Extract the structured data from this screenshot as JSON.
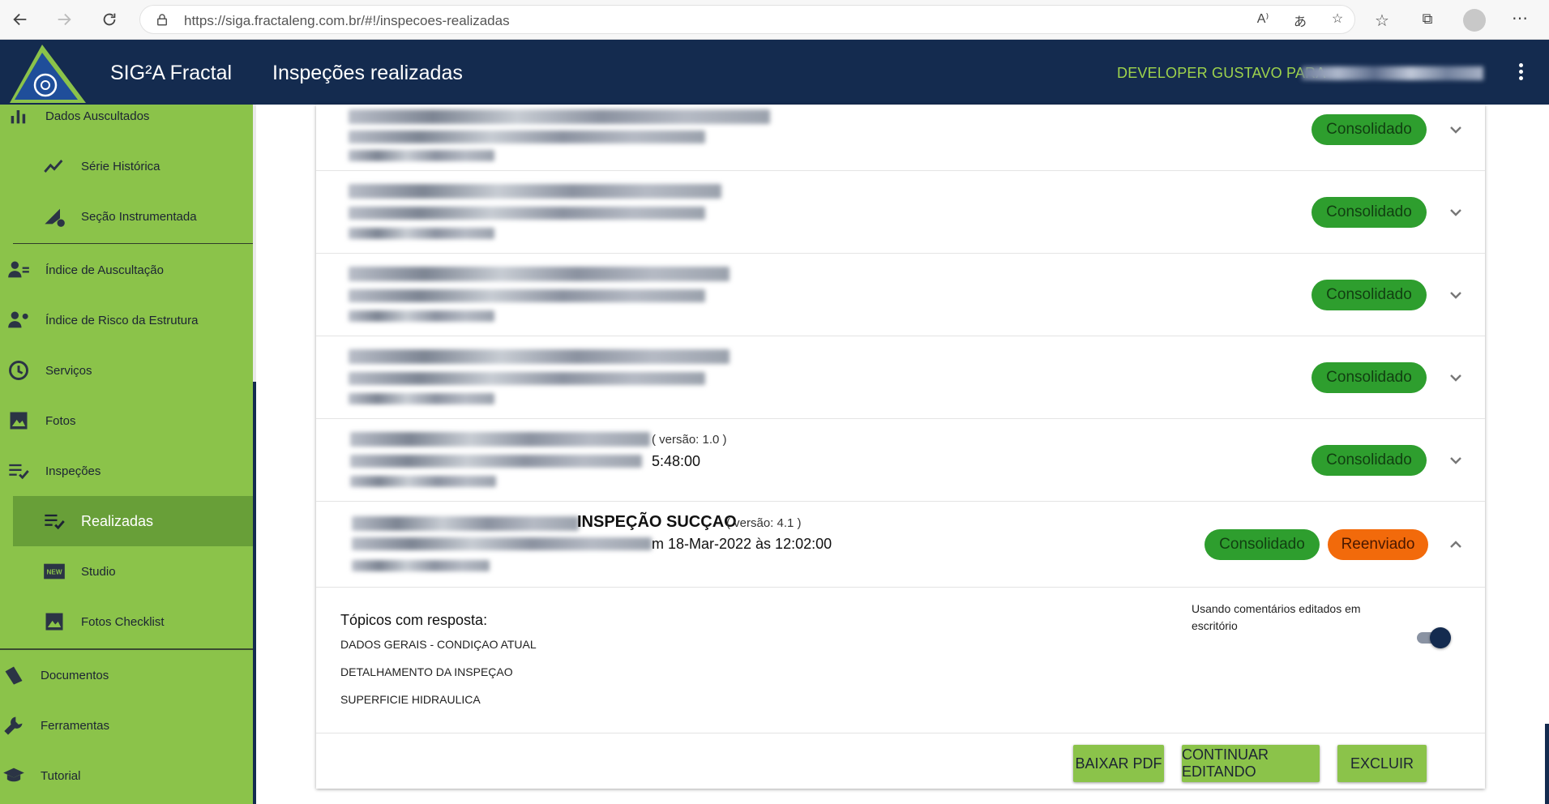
{
  "browser": {
    "url": "https://siga.fractaleng.com.br/#!/inspecoes-realizadas"
  },
  "header": {
    "app_name": "SIG²A Fractal",
    "page_title": "Inspeções realizadas",
    "user_name": "DEVELOPER GUSTAVO PARA"
  },
  "sidebar": {
    "items": [
      {
        "label": "Dados Auscultados",
        "icon": "bar-chart-icon"
      },
      {
        "label": "Série Histórica",
        "icon": "trend-line-icon"
      },
      {
        "label": "Seção Instrumentada",
        "icon": "ruler-gear-icon"
      },
      {
        "label": "Índice de Auscultação",
        "icon": "person-list-icon"
      },
      {
        "label": "Índice de Risco da Estrutura",
        "icon": "person-gear-icon"
      },
      {
        "label": "Serviços",
        "icon": "clock-icon"
      },
      {
        "label": "Fotos",
        "icon": "image-icon"
      },
      {
        "label": "Inspeções",
        "icon": "checklist-icon"
      },
      {
        "label": "Realizadas",
        "icon": "checklist-icon"
      },
      {
        "label": "Studio",
        "icon": "new-badge-icon"
      },
      {
        "label": "Fotos Checklist",
        "icon": "image-icon"
      },
      {
        "label": "Documentos",
        "icon": "documents-icon"
      },
      {
        "label": "Ferramentas",
        "icon": "wrench-icon"
      },
      {
        "label": "Tutorial",
        "icon": "graduation-cap-icon"
      }
    ]
  },
  "inspections": {
    "status_consolidated": "Consolidado",
    "status_resent": "Reenviado",
    "row5": {
      "version": "( versão: 1.0 )",
      "time": "5:48:00"
    },
    "row6": {
      "title": "INSPEÇÃO SUCÇAO",
      "version": "( versão: 4.1 )",
      "date": "m 18-Mar-2022 às 12:02:00"
    }
  },
  "details": {
    "topics_heading": "Tópicos com resposta:",
    "topics": [
      "DADOS GERAIS - CONDIÇAO ATUAL",
      "DETALHAMENTO DA INSPEÇAO",
      "SUPERFICIE HIDRAULICA"
    ],
    "toggle_label_1": "Usando comentários editados em",
    "toggle_label_2": "escritório",
    "toggle_on": true
  },
  "actions": {
    "download_pdf": "BAIXAR PDF",
    "continue_editing": "CONTINUAR EDITANDO",
    "delete": "EXCLUIR"
  },
  "colors": {
    "appbar": "#142b4f",
    "sidebar": "#8bc34a",
    "sidebar_selected": "#689f38",
    "chip_green": "#2e9e2e",
    "chip_orange": "#f26a0b",
    "user_name": "#9ed34c"
  }
}
